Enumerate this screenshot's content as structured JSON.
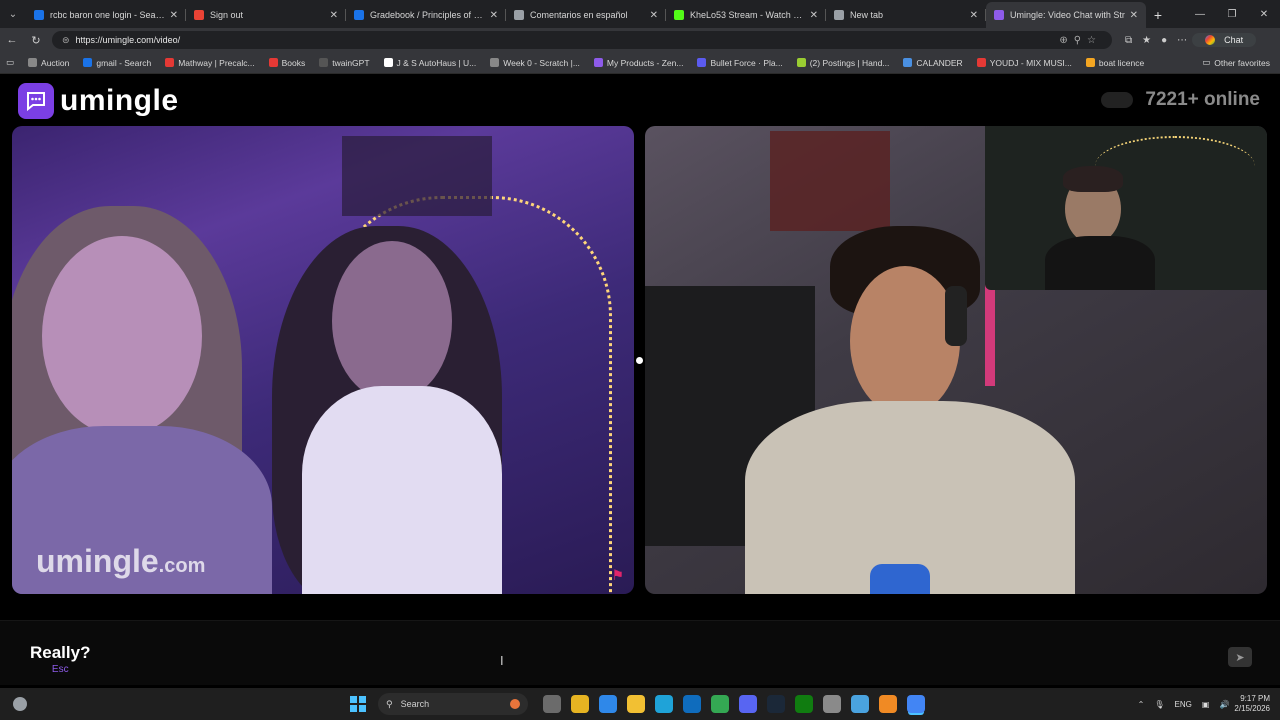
{
  "browser": {
    "tabs": [
      {
        "title": "rcbc baron one login - Search",
        "active": false,
        "color": "#1a73e8"
      },
      {
        "title": "Sign out",
        "active": false,
        "color": "#ea4335"
      },
      {
        "title": "Gradebook / Principles of Sociolo",
        "active": false,
        "color": "#1a73e8"
      },
      {
        "title": "Comentarios en español",
        "active": false,
        "color": "#9aa0a6"
      },
      {
        "title": "KheLo53 Stream - Watch Live on K",
        "active": false,
        "color": "#53fc18"
      },
      {
        "title": "New tab",
        "active": false,
        "color": "#9aa0a6"
      },
      {
        "title": "Umingle: Video Chat with Str",
        "active": true,
        "color": "#8e5bea"
      }
    ],
    "url": "https://umingle.com/video/",
    "chat_label": "Chat",
    "bookmarks": [
      {
        "label": "Auction",
        "color": "#888888"
      },
      {
        "label": "gmail - Search",
        "color": "#1a73e8"
      },
      {
        "label": "Mathway | Precalc...",
        "color": "#e53935"
      },
      {
        "label": "Books",
        "color": "#e53935"
      },
      {
        "label": "twainGPT",
        "color": "#555555"
      },
      {
        "label": "J & S AutoHaus | U...",
        "color": "#ffffff"
      },
      {
        "label": "Week 0 - Scratch |...",
        "color": "#888888"
      },
      {
        "label": "My Products - Zen...",
        "color": "#8e5bea"
      },
      {
        "label": "Bullet Force · Pla...",
        "color": "#5b5bf0"
      },
      {
        "label": "(2) Postings | Hand...",
        "color": "#9acd32"
      },
      {
        "label": "CALANDER",
        "color": "#4a90e2"
      },
      {
        "label": "YOUDJ - MIX MUSI...",
        "color": "#e53935"
      },
      {
        "label": "boat licence",
        "color": "#f4a622"
      }
    ],
    "other_bookmarks": "Other favorites"
  },
  "site": {
    "logo_text": "umingle",
    "online_text": "7221+ online",
    "watermark_main": "umingle",
    "watermark_suffix": ".com",
    "accent": "#7b3fe4"
  },
  "chat": {
    "skip_label": "Really?",
    "skip_hint": "Esc",
    "input_value": "",
    "input_placeholder": ""
  },
  "taskbar": {
    "search_label": "Search",
    "lang": "ENG",
    "time": "9:17 PM",
    "date": "2/15/2026",
    "apps": [
      {
        "name": "task-view",
        "color": "#6b6b6b"
      },
      {
        "name": "file-explorer-alt",
        "color": "#e6b422"
      },
      {
        "name": "copilot",
        "color": "#2f88e9"
      },
      {
        "name": "file-explorer",
        "color": "#f2c033"
      },
      {
        "name": "edge",
        "color": "#1fa3d8"
      },
      {
        "name": "outlook",
        "color": "#0f6cbd"
      },
      {
        "name": "chrome",
        "color": "#34a853"
      },
      {
        "name": "discord",
        "color": "#5865f2"
      },
      {
        "name": "steam",
        "color": "#1b2838"
      },
      {
        "name": "xbox",
        "color": "#107c10"
      },
      {
        "name": "settings",
        "color": "#8a8a8a"
      },
      {
        "name": "notepad",
        "color": "#4aa3df"
      },
      {
        "name": "app-orange",
        "color": "#f08a24"
      },
      {
        "name": "chrome-active",
        "color": "#4285f4"
      }
    ]
  }
}
